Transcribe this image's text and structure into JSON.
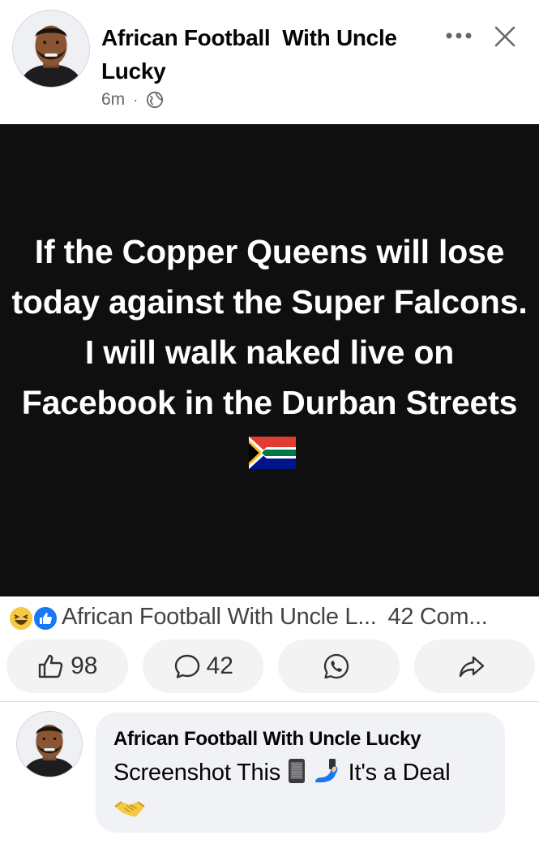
{
  "post": {
    "author": "African Football  With Uncle Lucky",
    "time": "6m",
    "separator": "·",
    "privacy_icon": "globe-icon",
    "text": "If the Copper Queens will lose today against the Super Falcons. I will walk naked live on Facebook in the Durban Streets",
    "flag_icon": "south-africa-flag-icon",
    "background_color": "#0f0f0f"
  },
  "reactions": {
    "icons": [
      "haha-icon",
      "like-icon"
    ],
    "names": "African Football  With Uncle L...",
    "comments": "42 Com..."
  },
  "actions": {
    "like_count": "98",
    "comment_count": "42",
    "whatsapp_icon": "whatsapp-icon",
    "share_icon": "share-icon"
  },
  "comment": {
    "author": "African Football  With Uncle Lucky",
    "text_before": "Screenshot This",
    "text_after": "It's a Deal",
    "emojis": [
      "mobile-phone-icon",
      "selfie-icon",
      "handshake-icon"
    ]
  }
}
